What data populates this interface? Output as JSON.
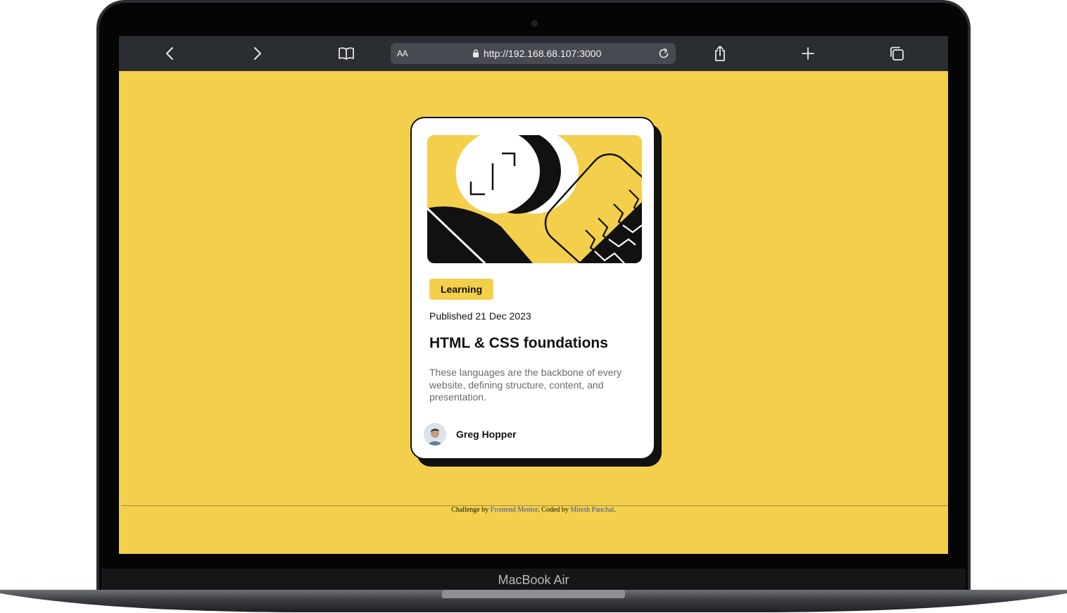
{
  "browser": {
    "text_size_label": "AA",
    "url": "http://192.168.68.107:3000"
  },
  "card": {
    "badge": "Learning",
    "published": "Published 21 Dec 2023",
    "title": "HTML & CSS foundations",
    "description": "These languages are the backbone of every website, defining structure, content, and presentation.",
    "author": "Greg Hopper"
  },
  "footer": {
    "prefix": "Challenge by ",
    "link1": "Frontend Mentor",
    "middle": ". Coded by ",
    "link2": "Mitesh Panchal",
    "suffix": "."
  },
  "device": {
    "label": "MacBook Air"
  },
  "colors": {
    "page_background": "#f4cf4b",
    "card_background": "#ffffff",
    "accent_yellow": "#f4cf4b",
    "text_dark": "#111111",
    "text_muted": "#6b6b6b",
    "toolbar": "#2a2d31",
    "link": "#3e52a3"
  }
}
